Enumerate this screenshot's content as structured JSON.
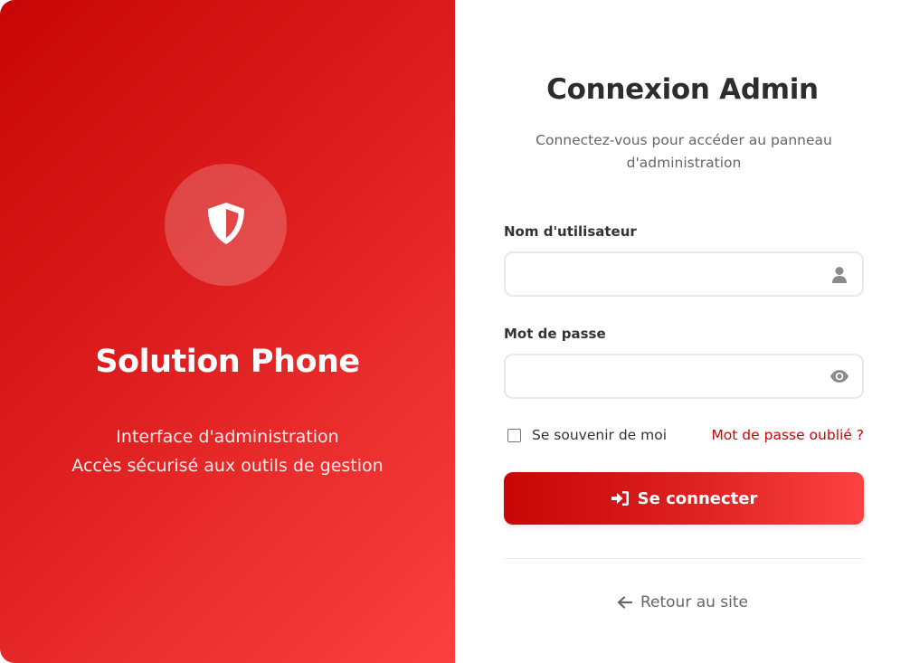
{
  "brand": {
    "name": "Solution Phone",
    "tagline_line1": "Interface d'administration",
    "tagline_line2": "Accès sécurisé aux outils de gestion",
    "logo_icon": "shield-icon"
  },
  "login": {
    "title": "Connexion Admin",
    "subtitle": "Connectez-vous pour accéder au panneau d'administration",
    "username": {
      "label": "Nom d'utilisateur",
      "value": "",
      "placeholder": "",
      "icon": "user-icon"
    },
    "password": {
      "label": "Mot de passe",
      "value": "",
      "placeholder": "",
      "icon": "eye-icon"
    },
    "remember_label": "Se souvenir de moi",
    "remember_checked": false,
    "forgot_label": "Mot de passe oublié ?",
    "submit_label": "Se connecter",
    "submit_icon": "sign-in-icon",
    "back_label": "Retour au site",
    "back_icon": "arrow-left-icon"
  },
  "colors": {
    "brand_red": "#c80606",
    "brand_red_light": "#fa4040",
    "text_dark": "#333333",
    "text_muted": "#666666"
  }
}
